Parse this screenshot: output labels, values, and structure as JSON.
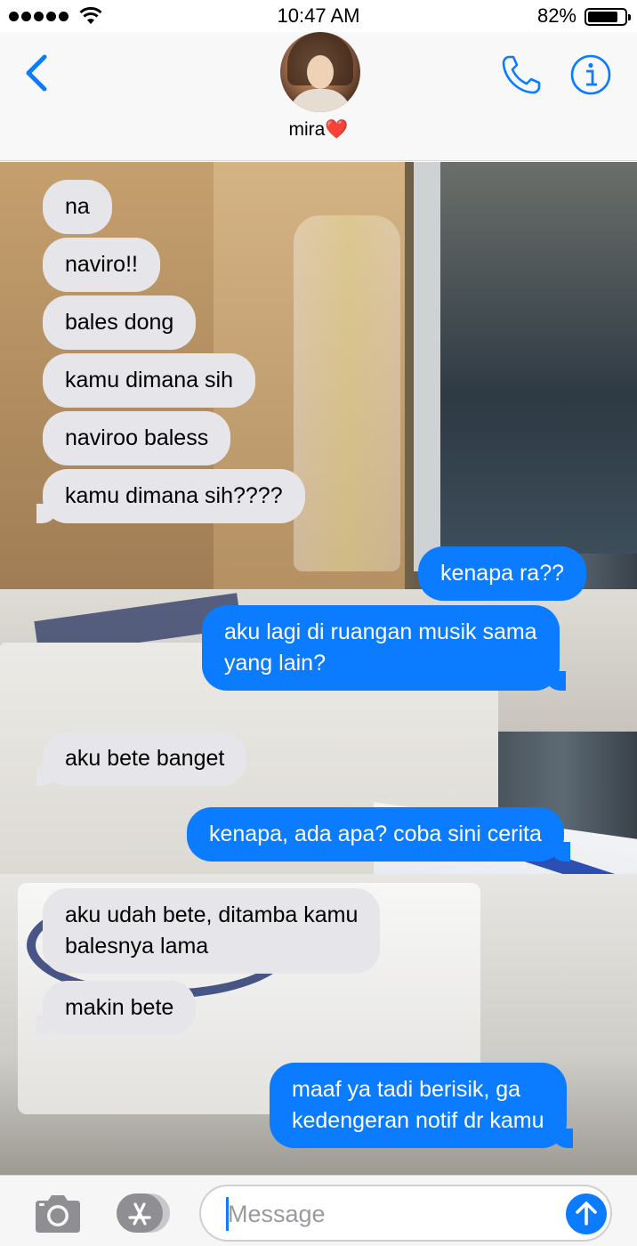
{
  "status_bar": {
    "time": "10:47 AM",
    "battery_percent": "82%",
    "battery_level": 0.82,
    "signal_icon": "signal-dots-icon",
    "wifi_icon": "wifi-icon"
  },
  "header": {
    "contact_name": "mira❤️",
    "back_icon": "chevron-left-icon",
    "call_icon": "phone-icon",
    "info_icon": "info-icon"
  },
  "messages": [
    {
      "sender": "them",
      "text": "na"
    },
    {
      "sender": "them",
      "text": "naviro!!"
    },
    {
      "sender": "them",
      "text": "bales dong"
    },
    {
      "sender": "them",
      "text": "kamu dimana sih"
    },
    {
      "sender": "them",
      "text": "naviroo baless"
    },
    {
      "sender": "them",
      "text": "kamu dimana sih????"
    },
    {
      "sender": "me",
      "text": "kenapa ra??"
    },
    {
      "sender": "me",
      "text": "aku lagi di ruangan musik sama",
      "text2": "yang lain?"
    },
    {
      "sender": "them",
      "text": "aku bete banget"
    },
    {
      "sender": "me",
      "text": "kenapa, ada apa? coba sini cerita"
    },
    {
      "sender": "them",
      "text": "aku udah bete, ditamba kamu",
      "text2": "balesnya lama"
    },
    {
      "sender": "them",
      "text": "makin bete"
    },
    {
      "sender": "me",
      "text": "maaf ya tadi berisik, ga",
      "text2": "kedengeran notif dr kamu"
    }
  ],
  "input_bar": {
    "placeholder": "Message",
    "camera_icon": "camera-icon",
    "apps_icon": "app-store-icon",
    "send_icon": "send-arrow-up-icon"
  },
  "colors": {
    "accent": "#0b7cff",
    "incoming_bubble": "#e5e5ea",
    "outgoing_bubble": "#0b7cff"
  }
}
